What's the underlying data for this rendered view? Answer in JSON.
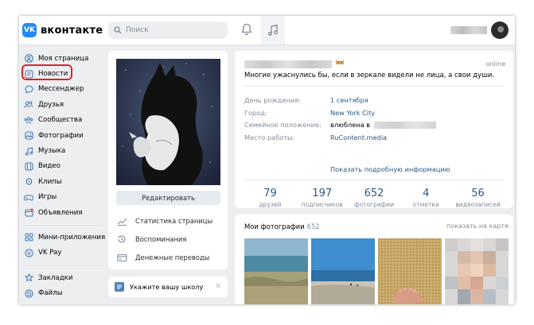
{
  "topbar": {
    "logo_mark": "VK",
    "logo_text": "вконтакте",
    "search_placeholder": "Поиск"
  },
  "sidebar": {
    "items": [
      {
        "label": "Моя страница",
        "icon": "user-circle-icon"
      },
      {
        "label": "Новости",
        "icon": "newspaper-icon",
        "highlighted": true
      },
      {
        "label": "Мессенджер",
        "icon": "message-icon"
      },
      {
        "label": "Друзья",
        "icon": "friends-icon"
      },
      {
        "label": "Сообщества",
        "icon": "communities-icon"
      },
      {
        "label": "Фотографии",
        "icon": "photo-icon"
      },
      {
        "label": "Музыка",
        "icon": "music-icon"
      },
      {
        "label": "Видео",
        "icon": "video-icon"
      },
      {
        "label": "Клипы",
        "icon": "clips-icon"
      },
      {
        "label": "Игры",
        "icon": "gamepad-icon"
      },
      {
        "label": "Объявления",
        "icon": "classifieds-icon"
      }
    ],
    "items2": [
      {
        "label": "Мини-приложения",
        "icon": "apps-icon"
      },
      {
        "label": "VK Pay",
        "icon": "vkpay-icon"
      }
    ],
    "items3": [
      {
        "label": "Закладки",
        "icon": "star-icon"
      },
      {
        "label": "Файлы",
        "icon": "file-icon"
      }
    ]
  },
  "profile": {
    "edit_button": "Редактировать",
    "links": [
      {
        "label": "Статистика страницы",
        "icon": "stats-icon"
      },
      {
        "label": "Воспоминания",
        "icon": "memories-icon"
      },
      {
        "label": "Денежные переводы",
        "icon": "money-transfer-icon"
      }
    ],
    "school_prompt": "Укажите вашу школу",
    "school_close": "✕"
  },
  "info": {
    "online": "online",
    "status": "Многие ужаснулись бы, если в зеркале видели не лица, а свои души.",
    "rows": [
      {
        "key": "День рождения:",
        "value": "1 сентября"
      },
      {
        "key": "Город:",
        "value": "New York City"
      },
      {
        "key": "Семейное положение:",
        "value": "влюблена в"
      },
      {
        "key": "Место работы:",
        "value": "RuContent.media"
      }
    ],
    "more_link": "Показать подробную информацию",
    "counters": [
      {
        "number": "79",
        "label": "друзей"
      },
      {
        "number": "197",
        "label": "подписчиков"
      },
      {
        "number": "652",
        "label": "фотографии"
      },
      {
        "number": "4",
        "label": "отметки"
      },
      {
        "number": "56",
        "label": "видеозаписей"
      }
    ]
  },
  "photos": {
    "title": "Мои фотографии",
    "count": "652",
    "map_link": "показать на карте"
  },
  "colors": {
    "accent": "#2787f5",
    "link": "#2a5885",
    "highlight": "#d6262c",
    "background": "#edeef0"
  }
}
